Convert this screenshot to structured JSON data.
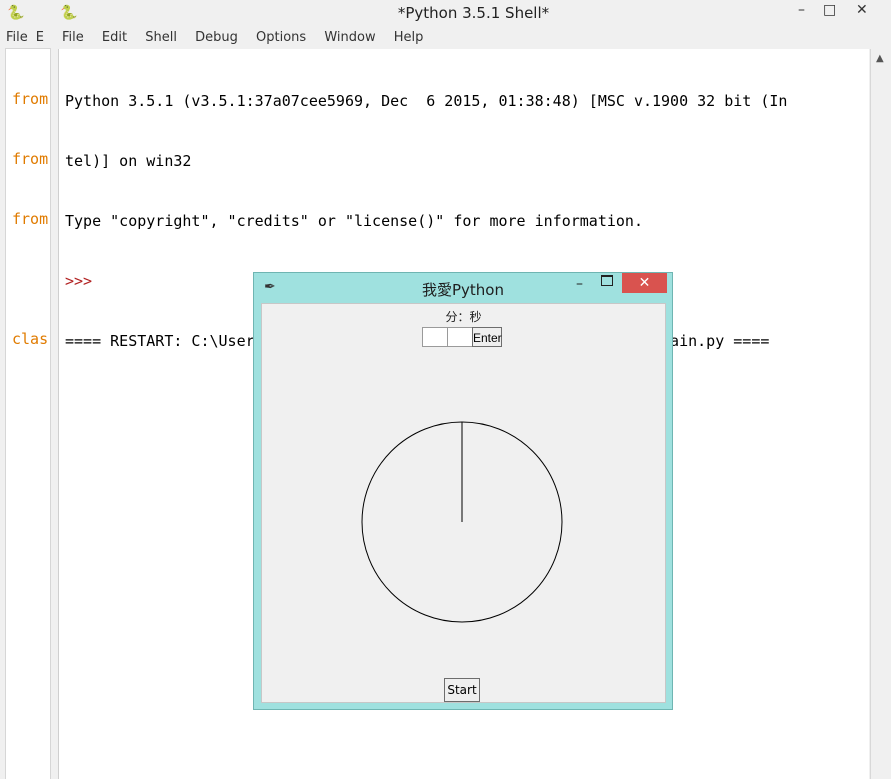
{
  "background_window": {
    "menu": [
      "File",
      "E"
    ],
    "code_lines": [
      "from",
      "from",
      "from",
      "",
      "clas"
    ]
  },
  "shell": {
    "title": "*Python 3.5.1 Shell*",
    "menu": [
      "File",
      "Edit",
      "Shell",
      "Debug",
      "Options",
      "Window",
      "Help"
    ],
    "lines": [
      "Python 3.5.1 (v3.5.1:37a07cee5969, Dec  6 2015, 01:38:48) [MSC v.1900 32 bit (In",
      "tel)] on win32",
      "Type \"copyright\", \"credits\" or \"license()\" for more information.",
      ">>>",
      "==== RESTART: C:\\Users\\visa1_000\\Documents\\GitHub\\LovePythonClock\\main.py ===="
    ]
  },
  "tk_window": {
    "title": "我愛Python",
    "label": "分：秒",
    "enter_label": "Enter",
    "start_label": "Start",
    "clock_hand_angle_deg": 0
  },
  "colors": {
    "tk_frame": "#9fe1df",
    "close_button": "#d9534f",
    "prompt": "#b22222",
    "code_keyword": "#e07b00"
  }
}
